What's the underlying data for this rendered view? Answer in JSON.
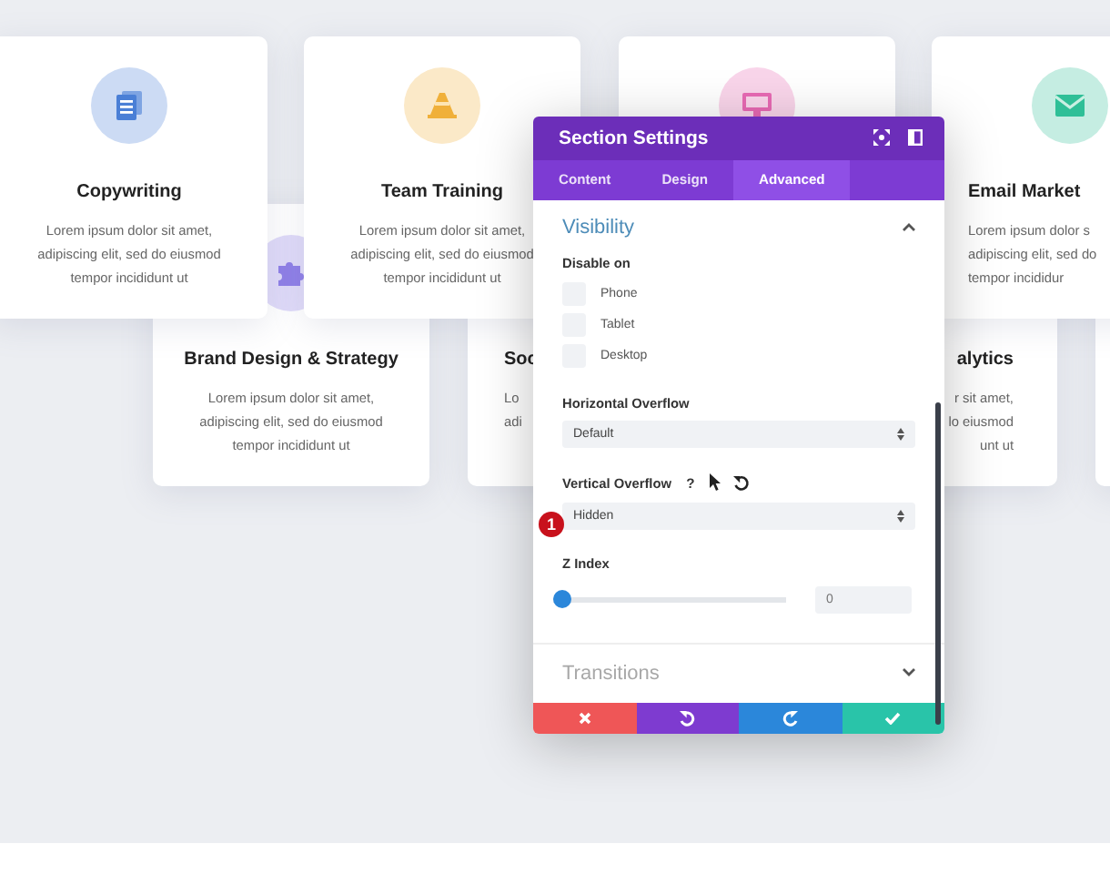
{
  "back_cards": [
    {
      "kind": "full",
      "title": "Brand Design & Strategy",
      "lines": [
        "Lorem ipsum dolor sit amet,",
        "adipiscing elit, sed do eiusmod",
        "tempor incididunt ut"
      ]
    },
    {
      "kind": "cut-right",
      "title": "Soc",
      "lines": [
        "Lo",
        "adi"
      ]
    },
    {
      "kind": "cut-left",
      "title": "alytics",
      "lines": [
        "r sit amet,",
        "lo eiusmod",
        "unt ut"
      ]
    },
    {
      "kind": "blank"
    }
  ],
  "front_cards": [
    {
      "kind": "full",
      "title": "Copywriting",
      "lines": [
        "Lorem ipsum dolor sit amet,",
        "adipiscing elit, sed do eiusmod",
        "tempor incididunt ut"
      ]
    },
    {
      "kind": "full",
      "title": "Team Training",
      "lines": [
        "Lorem ipsum dolor sit amet,",
        "adipiscing elit, sed do eiusmod",
        "tempor incididunt ut"
      ]
    },
    {
      "kind": "blank"
    },
    {
      "kind": "cut-right",
      "title": "Email Market",
      "lines": [
        "Lorem ipsum dolor s",
        "adipiscing elit, sed do",
        "tempor incididur"
      ]
    }
  ],
  "panel": {
    "title": "Section Settings",
    "tabs": [
      {
        "label": "Content",
        "selected": false
      },
      {
        "label": "Design",
        "selected": false
      },
      {
        "label": "Advanced",
        "selected": true
      }
    ],
    "section": {
      "title": "Visibility",
      "expanded": true
    },
    "disable_on": {
      "label": "Disable on",
      "options": [
        {
          "label": "Phone",
          "checked": false
        },
        {
          "label": "Tablet",
          "checked": false
        },
        {
          "label": "Desktop",
          "checked": false
        }
      ]
    },
    "horizontal_overflow": {
      "label": "Horizontal Overflow",
      "value": "Default"
    },
    "vertical_overflow": {
      "label": "Vertical Overflow",
      "help": "?",
      "value": "Hidden",
      "step_badge": "1"
    },
    "z_index": {
      "label": "Z Index",
      "level": 0,
      "placeholder": "0"
    },
    "collapsed_section": {
      "title": "Transitions",
      "expanded": false
    }
  }
}
